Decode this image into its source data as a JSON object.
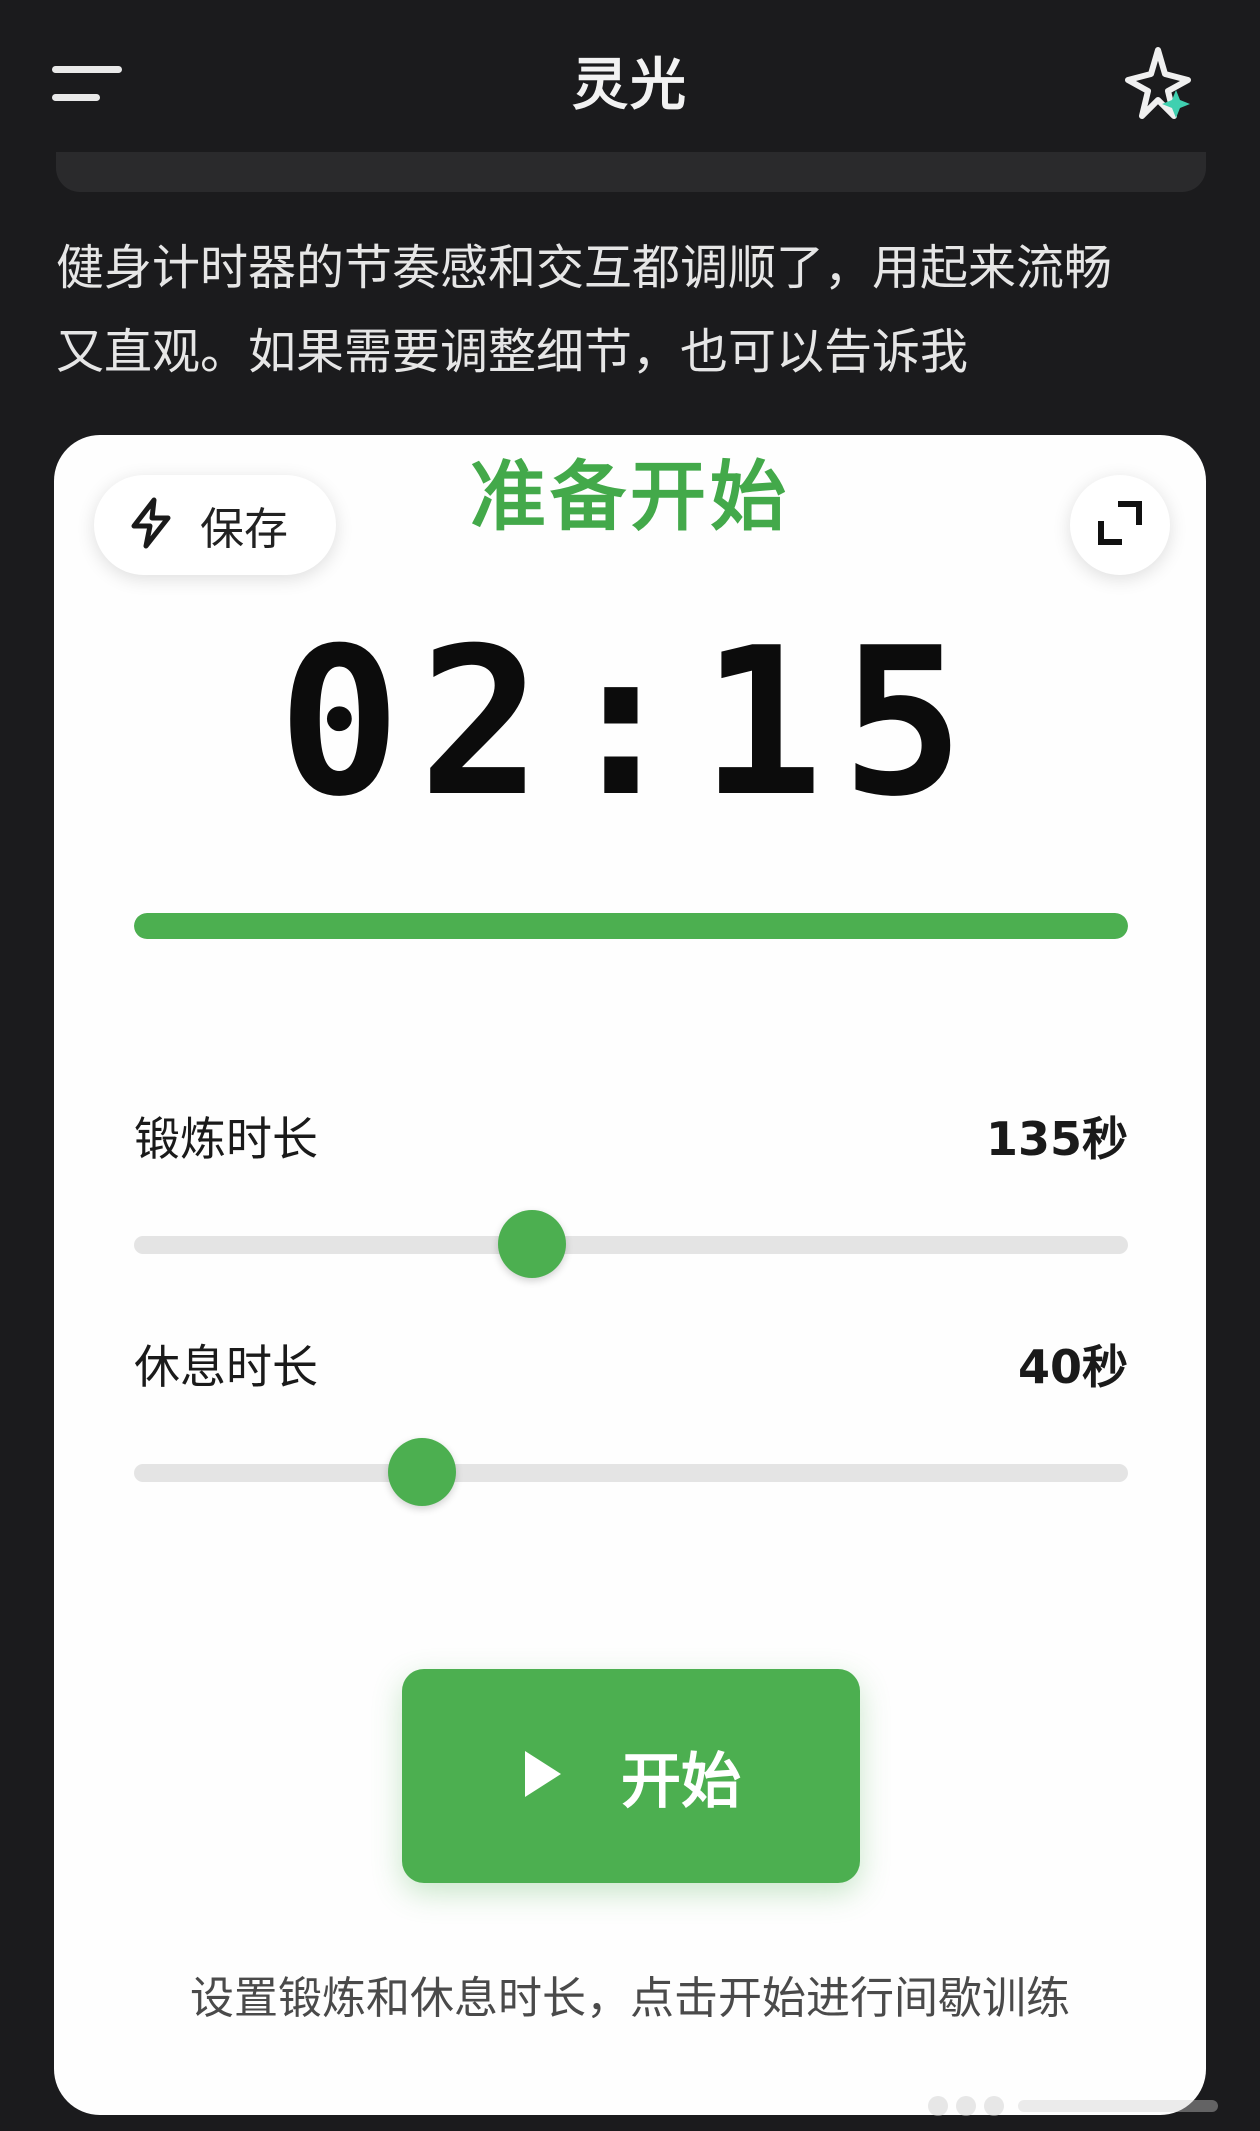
{
  "header": {
    "title": "灵光",
    "menu_icon": "menu-icon",
    "action_icon": "sparkle-icon"
  },
  "message": {
    "line1": "健身计时器的节奏感和交互都调顺了，用起来流畅",
    "line2": "又直观。如果需要调整细节，也可以告诉我"
  },
  "card": {
    "save_label": "保存",
    "save_icon": "lightning-icon",
    "status": "准备开始",
    "expand_icon": "expand-icon",
    "timer": "02:15",
    "progress": 1.0,
    "exercise": {
      "label": "锻炼时长",
      "value": "135秒",
      "fraction": 0.4
    },
    "rest": {
      "label": "休息时长",
      "value": "40秒",
      "fraction": 0.29
    },
    "start_label": "开始",
    "start_icon": "play-icon",
    "hint": "设置锻炼和休息时长，点击开始进行间歇训练"
  },
  "colors": {
    "accent": "#4caf50",
    "status_text": "#43a94a",
    "background": "#1b1b1d",
    "card": "#fefefe"
  }
}
